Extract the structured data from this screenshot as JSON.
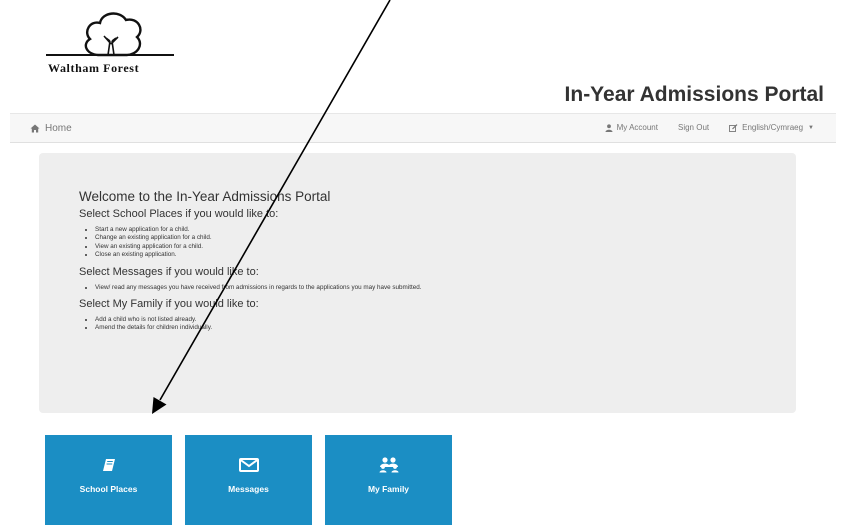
{
  "logo": {
    "text": "Waltham Forest",
    "icon": "oak-tree-logo"
  },
  "portal_title": "In-Year Admissions Portal",
  "nav": {
    "home": {
      "label": "Home",
      "icon": "home-icon"
    },
    "my_account": {
      "label": "My Account",
      "icon": "user-icon"
    },
    "sign_out": {
      "label": "Sign Out"
    },
    "language": {
      "label": "English/Cymraeg",
      "icon": "edit-icon"
    }
  },
  "welcome": {
    "title": "Welcome to the In-Year Admissions Portal",
    "sections": [
      {
        "heading": "Select School Places if you would like to:",
        "items": [
          "Start a new application for a child.",
          "Change an existing application for a child.",
          "View an existing application for a child.",
          "Close an existing application."
        ]
      },
      {
        "heading": "Select Messages if you would like to:",
        "items": [
          "View/ read any messages you have received from admissions in regards to the applications you may have submitted."
        ]
      },
      {
        "heading": "Select My Family if you would like to:",
        "items": [
          "Add a child who is not listed already.",
          "Amend the details for children individually."
        ]
      }
    ]
  },
  "tiles": [
    {
      "label": "School Places",
      "icon": "book-icon"
    },
    {
      "label": "Messages",
      "icon": "envelope-icon"
    },
    {
      "label": "My Family",
      "icon": "family-icon"
    }
  ],
  "colors": {
    "tile": "#1b8ec4",
    "panel": "#eeeeee",
    "navbar": "#f7f7f7"
  }
}
